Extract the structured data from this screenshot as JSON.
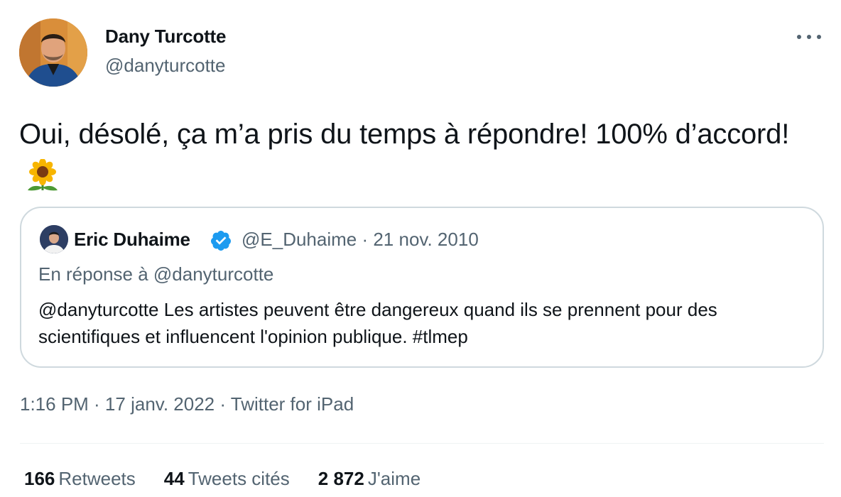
{
  "tweet": {
    "author": {
      "name": "Dany Turcotte",
      "handle": "@danyturcotte"
    },
    "text": "Oui, désolé, ça m’a pris du temps à répondre! 100% d’accord!",
    "emoji_icon": "sunflower-icon",
    "quoted": {
      "name": "Eric Duhaime",
      "verified_color": "#1d9bf0",
      "meta": "@E_Duhaime · 21 nov. 2010",
      "reply_to": "En réponse à @danyturcotte",
      "text": "@danyturcotte Les artistes peuvent être dangereux quand ils se prennent pour des scientifiques et influencent l'opinion publique. #tlmep"
    },
    "timestamp": "1:16 PM · 17 janv. 2022 · Twitter for iPad",
    "stats": [
      {
        "count": "166",
        "label": "Retweets"
      },
      {
        "count": "44",
        "label": "Tweets cités"
      },
      {
        "count": "2 872",
        "label": "J'aime"
      }
    ]
  }
}
